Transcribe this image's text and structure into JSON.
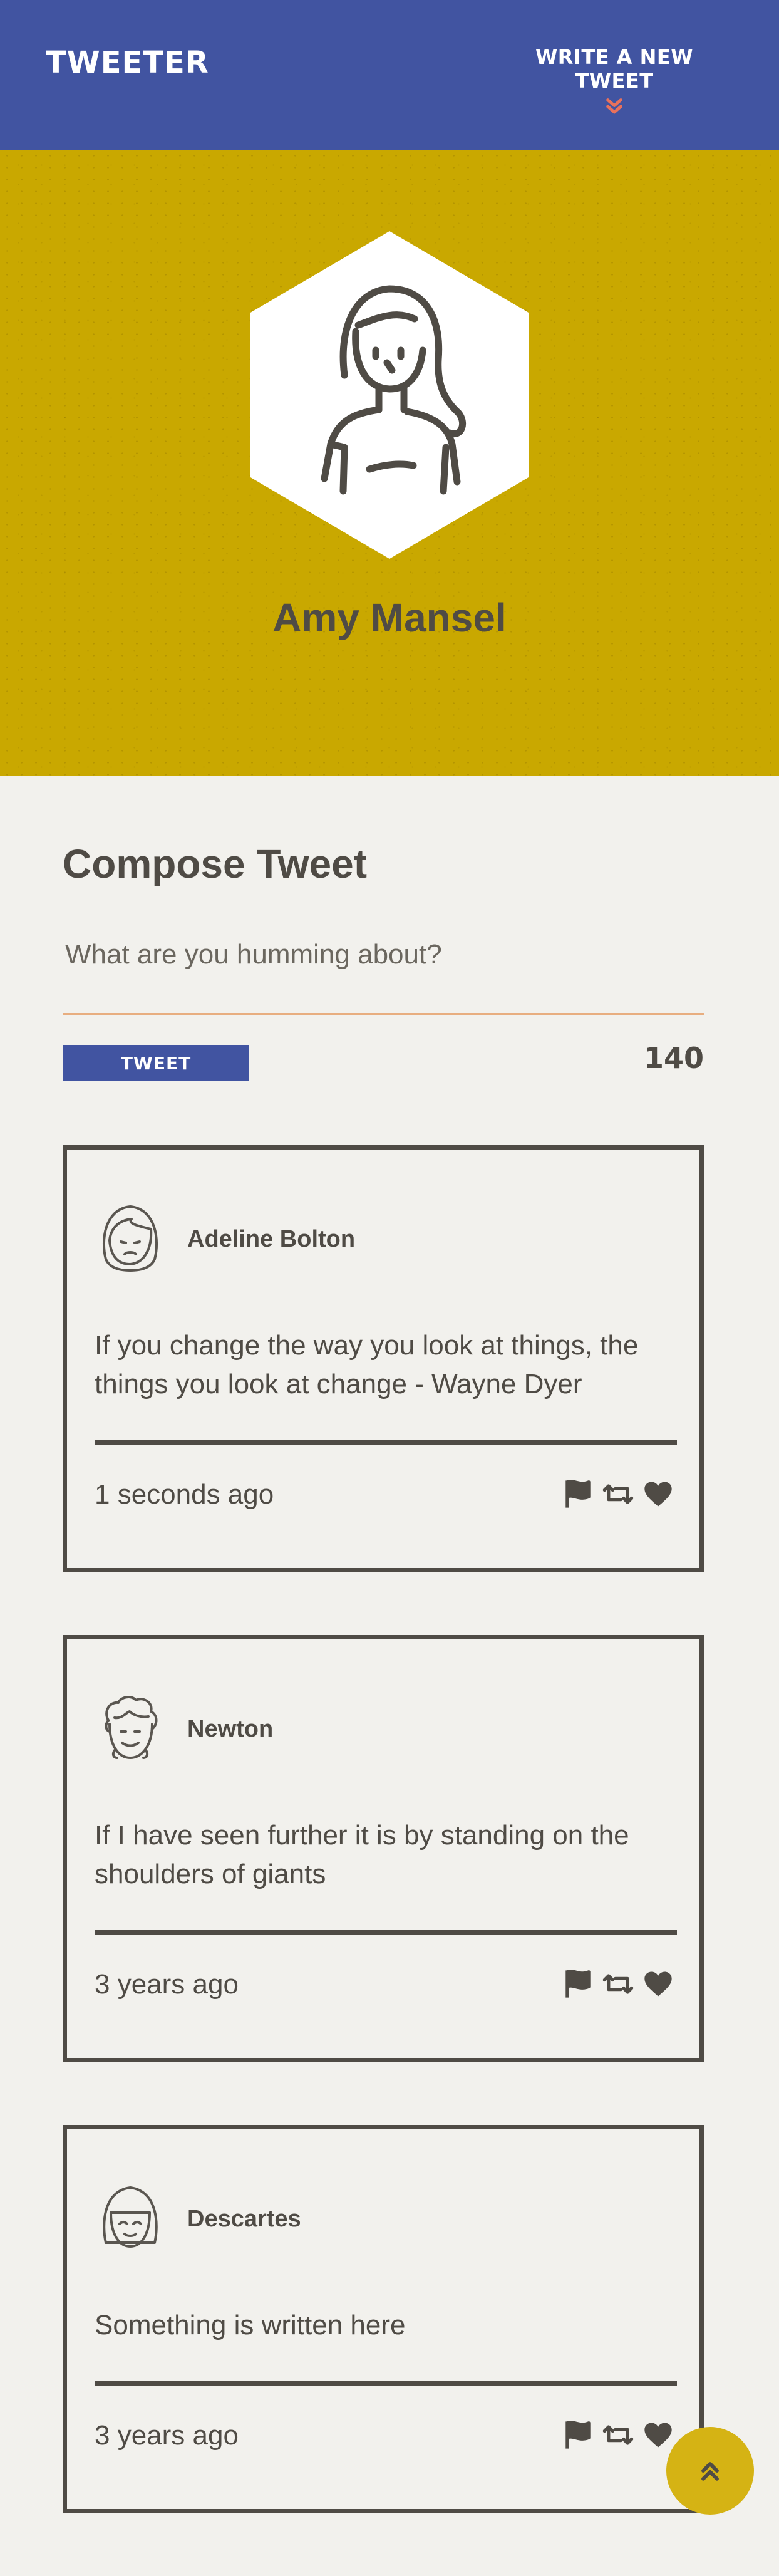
{
  "nav": {
    "brand": "TWEETER",
    "compose_link": "WRITE A NEW TWEET",
    "compose_icon": "double-chevron-down-icon",
    "bg_color": "#4154a1",
    "accent_color": "#e8715c"
  },
  "profile": {
    "name": "Amy Mansel",
    "avatar_icon": "woman-avatar-icon",
    "bg_color": "#c9a800"
  },
  "compose": {
    "title": "Compose Tweet",
    "placeholder": "What are you humming about?",
    "button_label": "TWEET",
    "counter": "140"
  },
  "tweets": [
    {
      "handle": "Adeline Bolton",
      "avatar_icon": "girl-avatar-icon",
      "text": "If you change the way you look at things, the things you look at change - Wayne Dyer",
      "time": "1 seconds ago",
      "actions": [
        "flag-icon",
        "retweet-icon",
        "heart-icon"
      ]
    },
    {
      "handle": "Newton",
      "avatar_icon": "curly-hair-avatar-icon",
      "text": "If I have seen further it is by standing on the shoulders of giants",
      "time": "3 years ago",
      "actions": [
        "flag-icon",
        "retweet-icon",
        "heart-icon"
      ]
    },
    {
      "handle": "Descartes",
      "avatar_icon": "bob-hair-avatar-icon",
      "text": "Something is written here",
      "time": "3 years ago",
      "actions": [
        "flag-icon",
        "retweet-icon",
        "heart-icon"
      ]
    }
  ],
  "scroll_top_icon": "double-chevron-up-icon"
}
